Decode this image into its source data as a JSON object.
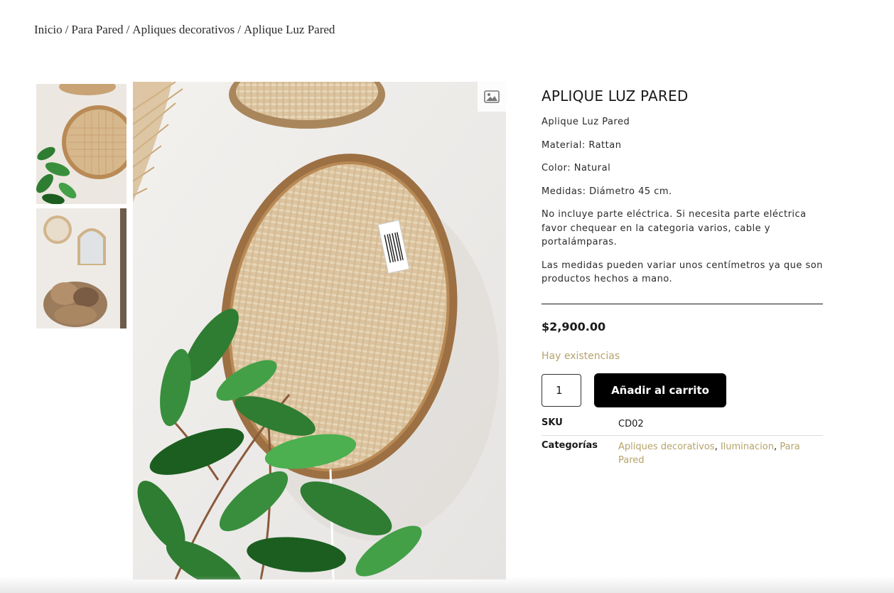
{
  "breadcrumb": {
    "items": [
      "Inicio",
      "Para Pared",
      "Apliques decorativos",
      "Aplique Luz Pared"
    ],
    "separator": "/"
  },
  "gallery": {
    "zoom_icon": "image-icon",
    "thumbnails": [
      "thumbnail-rattan-wall-light",
      "thumbnail-mirrors-dried-flowers"
    ]
  },
  "product": {
    "title": "APLIQUE LUZ PARED",
    "description": [
      "Aplique Luz Pared",
      "Material: Rattan",
      "Color: Natural",
      "Medidas: Diámetro 45 cm.",
      "No incluye parte eléctrica. Si necesita parte eléctrica favor chequear en la categoria varios, cable y portalámparas.",
      "Las medidas pueden variar unos centímetros ya que son productos hechos a mano."
    ],
    "price": "$2,900.00",
    "stock": "Hay existencias",
    "quantity": "1",
    "add_to_cart": "Añadir al carrito",
    "sku_label": "SKU",
    "sku": "CD02",
    "categories_label": "Categorías",
    "categories": [
      "Apliques decorativos",
      "Iluminacion",
      "Para Pared"
    ]
  },
  "colors": {
    "accent": "#b5a36a",
    "button": "#000000",
    "text": "#1a1a1a"
  }
}
